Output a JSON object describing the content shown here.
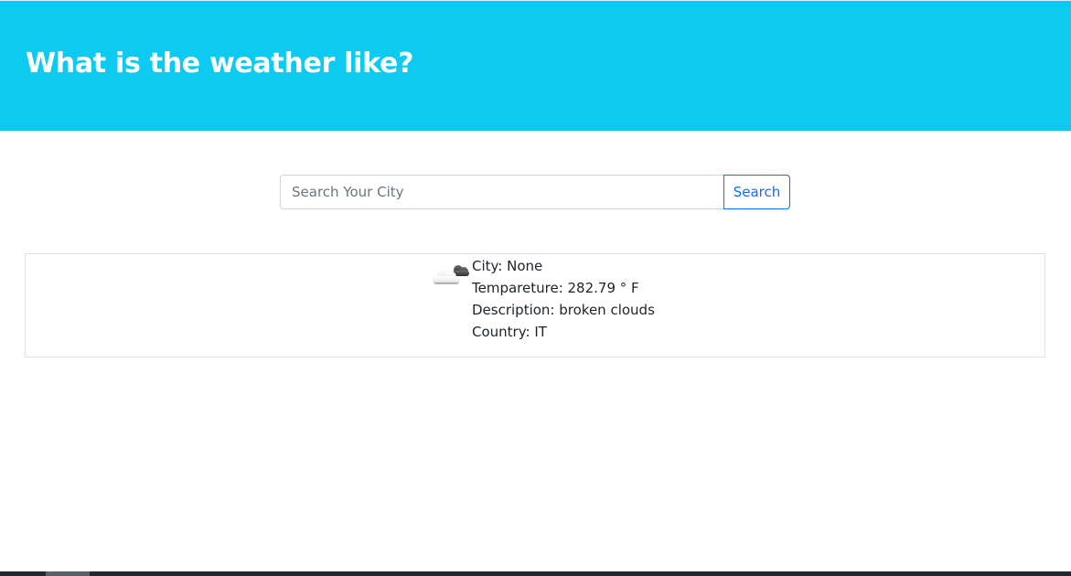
{
  "header": {
    "title": "What is the weather like?"
  },
  "search": {
    "placeholder": "Search Your City",
    "value": "",
    "button_label": "Search"
  },
  "result": {
    "icon": "broken-clouds-icon",
    "city": "City: None",
    "temperature": "Tempareture: 282.79 ° F",
    "description": "Description: broken clouds",
    "country": "Country: IT"
  },
  "colors": {
    "header_bg": "#0dcaf0",
    "button_accent": "#0d6efd"
  }
}
